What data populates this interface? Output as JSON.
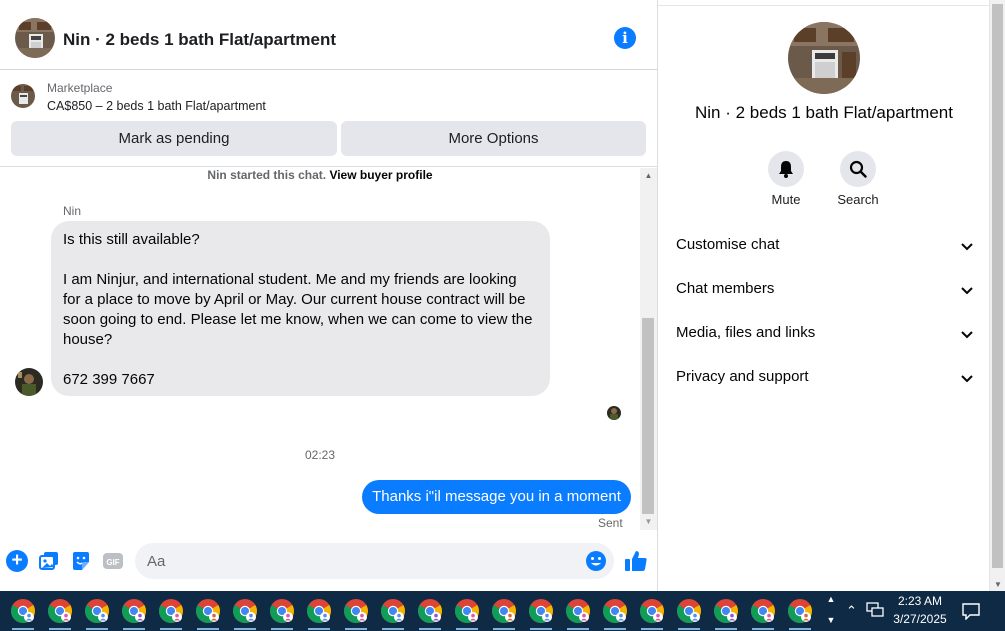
{
  "header": {
    "title": "Nin · 2 beds 1 bath Flat/apartment",
    "info_icon": "info-icon",
    "info_glyph": "i"
  },
  "marketplace": {
    "label": "Marketplace",
    "item": "CA$850 – 2 beds 1 bath Flat/apartment",
    "pending_button": "Mark as pending",
    "more_button": "More Options"
  },
  "chat": {
    "started_text": "Nin started this chat.",
    "buyer_profile_link": "View buyer profile",
    "sender_name": "Nin",
    "incoming": {
      "line1": "Is this still available?",
      "line2": "I am Ninjur, and international student. Me and my friends are looking for a place to move by April or May. Our current house contract will be soon going to end. Please let me know, when we can come to view the house?",
      "line3": "672 399 7667"
    },
    "timestamp": "02:23",
    "outgoing": "Thanks i\"il message you in a moment",
    "sent_status": "Sent"
  },
  "composer": {
    "placeholder": "Aa",
    "gif_label": "GIF",
    "plus_glyph": "+"
  },
  "info_panel": {
    "title": "Nin · 2 beds 1 bath Flat/apartment",
    "mute_label": "Mute",
    "search_label": "Search",
    "sections": [
      "Customise chat",
      "Chat members",
      "Media, files and links",
      "Privacy and support"
    ]
  },
  "taskbar": {
    "app_count": 22,
    "time": "2:23 AM",
    "date": "3/27/2025"
  },
  "colors": {
    "accent": "#0a7cff",
    "incoming_bubble": "#e9e9eb",
    "button_bg": "#e4e6eb",
    "taskbar": "#0f2a44"
  }
}
